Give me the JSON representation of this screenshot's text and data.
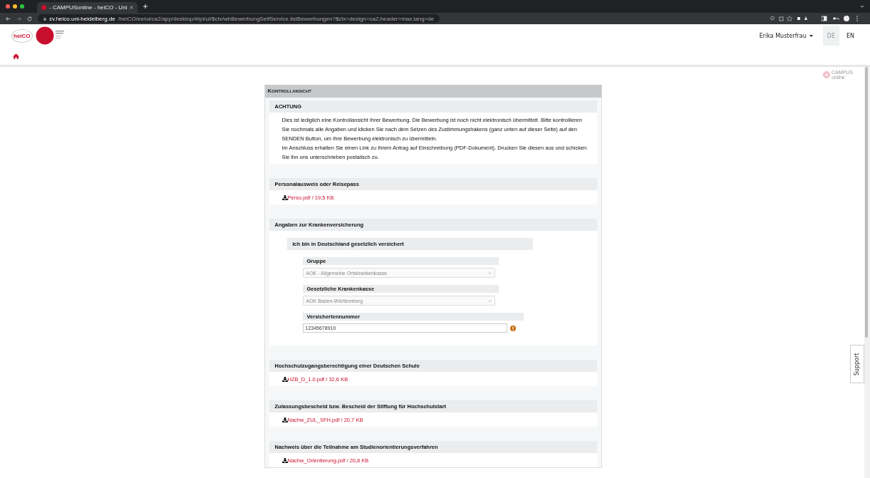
{
  "browser": {
    "tab_title": "- CAMPUSonline - heiCO - Uni",
    "url_host": "zv.heico.uni-heidelberg.de",
    "url_path": "/heiCO/ee/ui/ca2/app/desktop/#/pl/ui/$ctx/wbBewerbungSelfService.listBewerbungen?$ctx=design=ca2;header=max;lang=de"
  },
  "header": {
    "logo_text": "heiCO",
    "user_name": "Erika Musterfrau",
    "languages": [
      {
        "label": "DE",
        "selected": true
      },
      {
        "label": "EN",
        "selected": false
      }
    ]
  },
  "vendor_logo": {
    "line_1": "CAMPUS",
    "line_2": "online"
  },
  "page": {
    "title": "Kontrollansicht",
    "notice": {
      "heading": "ACHTUNG",
      "paragraphs": [
        "Dies ist lediglich eine Kontrollansicht Ihrer Bewerbung. Die Bewerbung ist noch nicht elektronisch übermittelt. Bitte kontrollieren Sie nochmals alle Angaben und klicken Sie nach dem Setzen des Zustimmungshakens (ganz unten auf dieser Seite) auf den SENDEN Button, um Ihre Bewerbung elektronisch zu übermitteln.",
        "Im Anschluss erhalten Sie einen Link zu Ihrem Antrag auf Einschreibung (PDF-Dokument). Drucken Sie diesen aus und schicken Sie ihn uns unterschrieben postalisch zu."
      ]
    },
    "sections": [
      {
        "kind": "file",
        "heading": "Personalausweis oder Reisepass",
        "file": "Perso.pdf / 19,5 KB"
      },
      {
        "kind": "insurance",
        "heading": "Angaben zur Krankenversicherung",
        "subheading": "Ich bin in Deutschland gesetzlich versichert",
        "fields": [
          {
            "kind": "select",
            "label": "Gruppe",
            "value": "AOK - Allgemeine Ortskrankenkasse",
            "disabled": true
          },
          {
            "kind": "select",
            "label": "Gesetzliche Krankenkasse",
            "value": "AOK Baden-Württemberg",
            "disabled": true
          },
          {
            "kind": "text",
            "label": "Versichertennummer",
            "value": "12345678910",
            "warning": true
          }
        ]
      },
      {
        "kind": "file",
        "heading": "Hochschulzugangsberechtigung einer Deutschen Schule",
        "file": "HZB_D_1.0.pdf / 32,6 KB"
      },
      {
        "kind": "file",
        "heading": "Zulassungsbescheid bzw. Bescheid der Stiftung für Hochschulstart",
        "file": "Nachw_ZUL_SFH.pdf / 20,7 KB"
      },
      {
        "kind": "file",
        "heading": "Nachweis über die Teilnahme am Studienorientierungsverfahren",
        "file": "Nachw_Orientierung.pdf / 20,8 KB"
      }
    ]
  },
  "support_tab": "Support"
}
